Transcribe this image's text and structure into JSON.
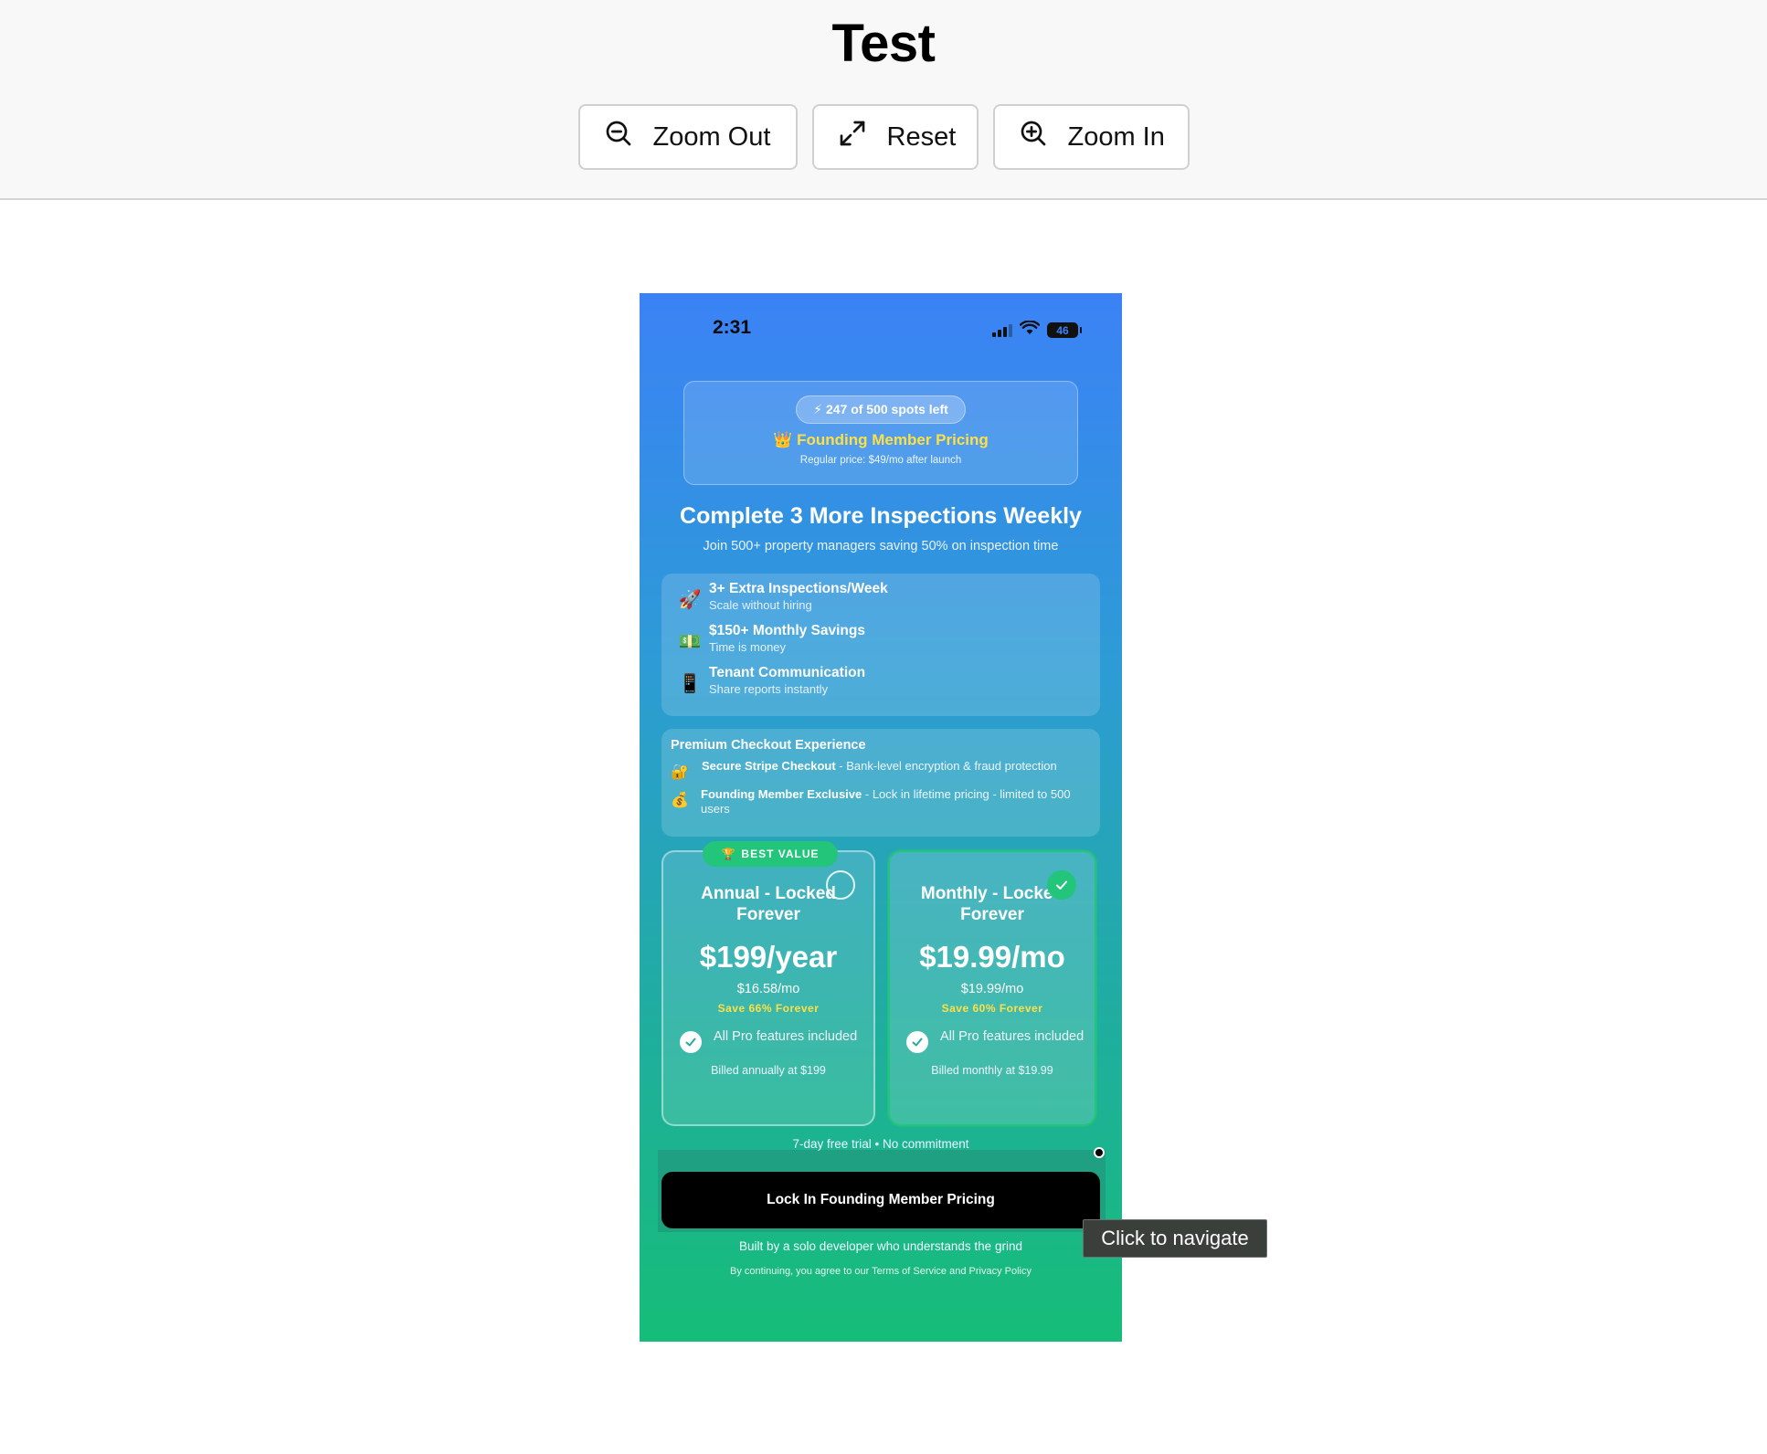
{
  "page": {
    "title": "Test"
  },
  "toolbar": {
    "zoom_out_label": "Zoom Out",
    "reset_label": "Reset",
    "zoom_in_label": "Zoom In"
  },
  "phone": {
    "status": {
      "time": "2:31",
      "battery": "46"
    },
    "promo": {
      "spots": "247 of 500 spots left",
      "founding": "Founding Member Pricing",
      "regular": "Regular price: $49/mo after launch"
    },
    "headline": "Complete 3 More Inspections Weekly",
    "subline": "Join 500+ property managers saving 50% on inspection time",
    "benefits": [
      {
        "icon": "rocket-icon",
        "title": "3+ Extra Inspections/Week",
        "subtitle": "Scale without hiring"
      },
      {
        "icon": "money-icon",
        "title": "$150+ Monthly Savings",
        "subtitle": "Time is money"
      },
      {
        "icon": "phone-icon",
        "title": "Tenant Communication",
        "subtitle": "Share reports instantly"
      }
    ],
    "checkout": {
      "title": "Premium Checkout Experience",
      "items": [
        {
          "icon": "lock-icon",
          "bold": "Secure Stripe Checkout",
          "text": " - Bank-level encryption & fraud protection"
        },
        {
          "icon": "money-bag-icon",
          "bold": "Founding Member Exclusive",
          "text": " - Lock in lifetime pricing - limited to 500 users"
        }
      ]
    },
    "plans": {
      "annual": {
        "badge": "BEST VALUE",
        "name": "Annual - Locked Forever",
        "price": "$199/year",
        "per_month": "$16.58/mo",
        "save": "Save 66% Forever",
        "feature": "All Pro features included",
        "billed": "Billed annually at $199",
        "selected": false
      },
      "monthly": {
        "name": "Monthly - Locked Forever",
        "price": "$19.99/mo",
        "per_month": "$19.99/mo",
        "save": "Save 60% Forever",
        "feature": "All Pro features included",
        "billed": "Billed monthly at $19.99",
        "selected": true
      }
    },
    "trial": "7-day free trial • No commitment",
    "cta": "Lock In Founding Member Pricing",
    "built_by": "Built by a solo developer who understands the grind",
    "terms": "By continuing, you agree to our Terms of Service and Privacy Policy"
  },
  "tooltip": "Click to navigate",
  "colors": {
    "accent_green": "#22c57a",
    "gold": "#fde047",
    "blue_top": "#3b82f6",
    "green_bottom": "#16bd78"
  }
}
